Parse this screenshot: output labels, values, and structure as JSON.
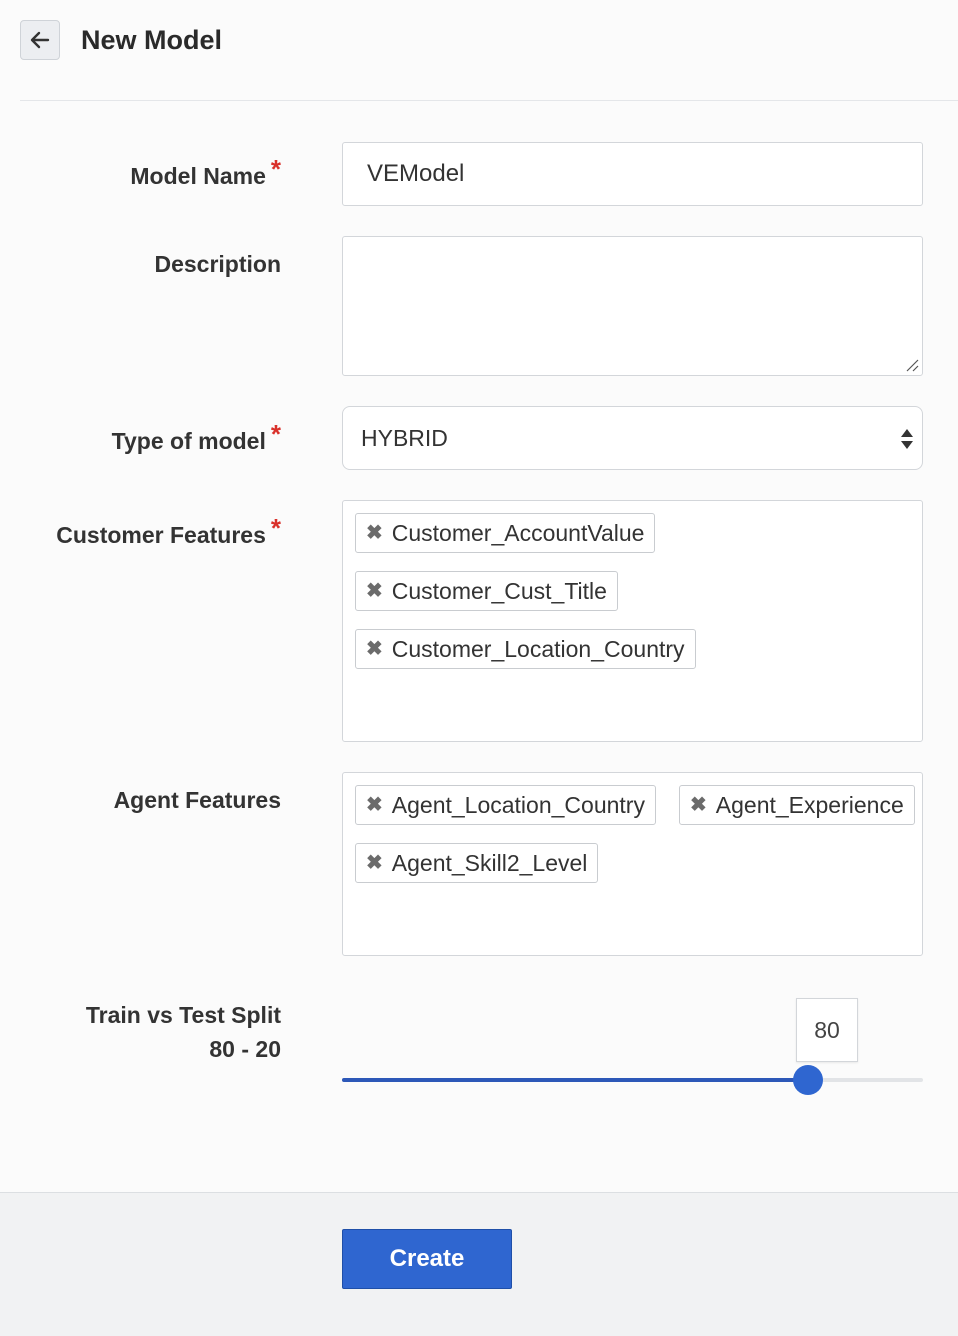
{
  "header": {
    "title": "New Model",
    "back_icon": "arrow-left-icon"
  },
  "form": {
    "model_name": {
      "label": "Model Name",
      "required_mark": "*",
      "value": "VEModel"
    },
    "description": {
      "label": "Description",
      "value": ""
    },
    "model_type": {
      "label": "Type of model",
      "required_mark": "*",
      "selected": "HYBRID"
    },
    "customer_features": {
      "label": "Customer Features",
      "required_mark": "*",
      "remove_glyph": "✖",
      "items": [
        "Customer_AccountValue",
        "Customer_Cust_Title",
        "Customer_Location_Country"
      ]
    },
    "agent_features": {
      "label": "Agent Features",
      "remove_glyph": "✖",
      "items": [
        "Agent_Location_Country",
        "Agent_Experience",
        "Agent_Skill2_Level"
      ]
    },
    "split": {
      "label": "Train vs Test Split",
      "ratio_text": "80 - 20",
      "value": "80",
      "percent": 80
    }
  },
  "footer": {
    "create_label": "Create"
  },
  "colors": {
    "primary": "#2f66d0",
    "required": "#d9302a"
  }
}
